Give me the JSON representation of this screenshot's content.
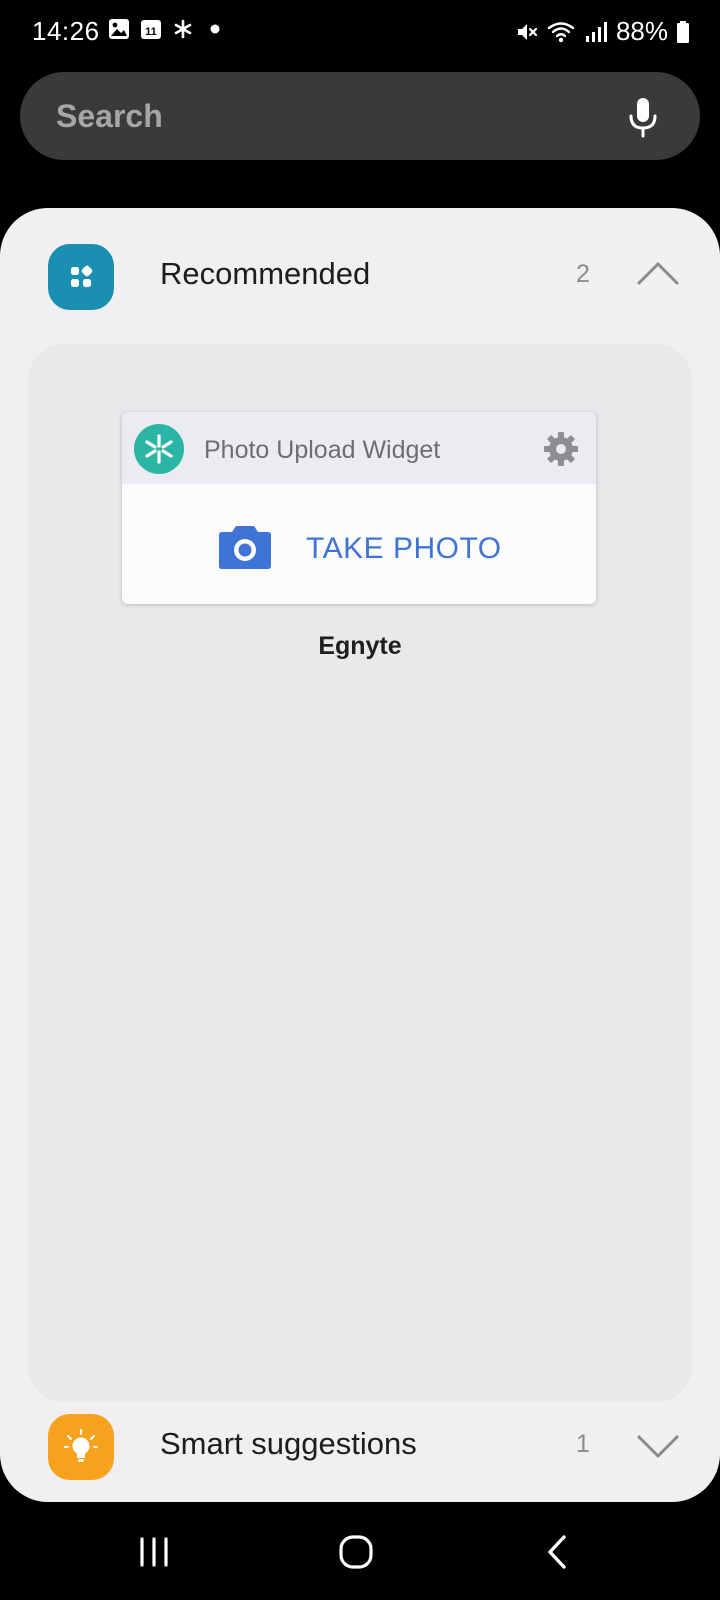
{
  "status_bar": {
    "time": "14:26",
    "calendar_day": "11",
    "battery": "88%"
  },
  "search": {
    "placeholder": "Search"
  },
  "sections": {
    "recommended": {
      "title": "Recommended",
      "count": "2",
      "expanded": true,
      "icon_color": "#1b8fb1"
    },
    "smart_suggestions": {
      "title": "Smart suggestions",
      "count": "1",
      "expanded": false,
      "icon_color": "#f7a21c"
    }
  },
  "widget": {
    "title": "Photo Upload Widget",
    "action_label": "TAKE PHOTO",
    "app_name": "Egnyte",
    "logo_color": "#2bb5a4",
    "accent_color": "#3f73d6"
  },
  "icons": {
    "status": [
      "gallery-icon",
      "calendar-icon",
      "asterisk-icon",
      "dot-icon"
    ],
    "status_right": [
      "mute-icon",
      "wifi-icon",
      "signal-icon",
      "battery-icon"
    ],
    "nav": [
      "recents-icon",
      "home-icon",
      "back-icon"
    ]
  }
}
